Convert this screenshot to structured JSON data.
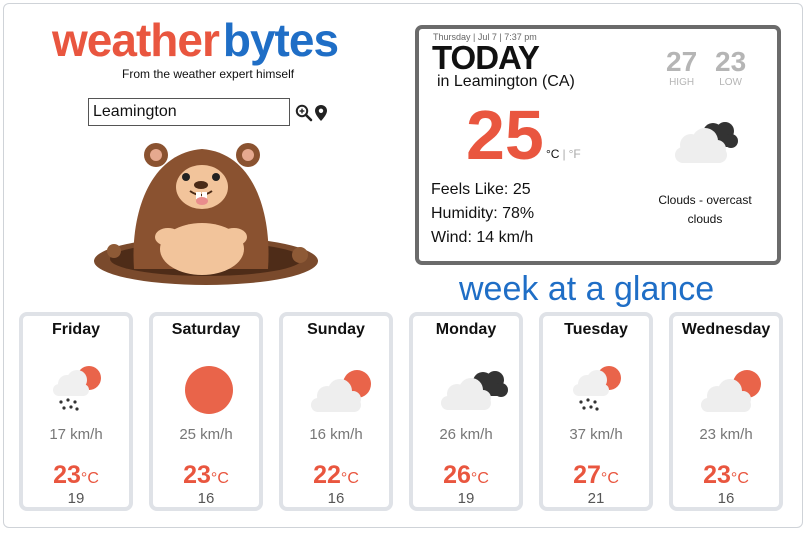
{
  "header": {
    "logo_part1": "weather",
    "logo_part2": "bytes",
    "tagline": "From the weather expert himself"
  },
  "search": {
    "value": "Leamington",
    "search_icon": "magnifier-icon",
    "location_icon": "map-pin-icon"
  },
  "today": {
    "date": "Thursday | Jul 7 | 7:37 pm",
    "title": "TODAY",
    "location": "in Leamington (CA)",
    "temp": "25",
    "unit_c": "°C",
    "unit_sep": "|",
    "unit_f": "°F",
    "high": "27",
    "high_label": "HIGH",
    "low": "23",
    "low_label": "LOW",
    "condition": "Clouds - overcast clouds",
    "feels_like": "Feels Like: 25",
    "humidity": "Humidity: 78%",
    "wind": "Wind: 14 km/h"
  },
  "week": {
    "title": "week at a glance",
    "days": [
      {
        "day": "Friday",
        "icon": "rain-sun-icon",
        "wind": "17 km/h",
        "high": "23",
        "unit": "°C",
        "low": "19"
      },
      {
        "day": "Saturday",
        "icon": "sun-icon",
        "wind": "25 km/h",
        "high": "23",
        "unit": "°C",
        "low": "16"
      },
      {
        "day": "Sunday",
        "icon": "partly-cloudy-icon",
        "wind": "16 km/h",
        "high": "22",
        "unit": "°C",
        "low": "16"
      },
      {
        "day": "Monday",
        "icon": "overcast-icon",
        "wind": "26 km/h",
        "high": "26",
        "unit": "°C",
        "low": "19"
      },
      {
        "day": "Tuesday",
        "icon": "rain-sun-icon",
        "wind": "37 km/h",
        "high": "27",
        "unit": "°C",
        "low": "21"
      },
      {
        "day": "Wednesday",
        "icon": "partly-cloudy-icon",
        "wind": "23 km/h",
        "high": "23",
        "unit": "°C",
        "low": "16"
      }
    ]
  },
  "colors": {
    "accent_red": "#e9563f",
    "brand_blue": "#1f6ec6",
    "card_border": "#dfe2e7"
  }
}
